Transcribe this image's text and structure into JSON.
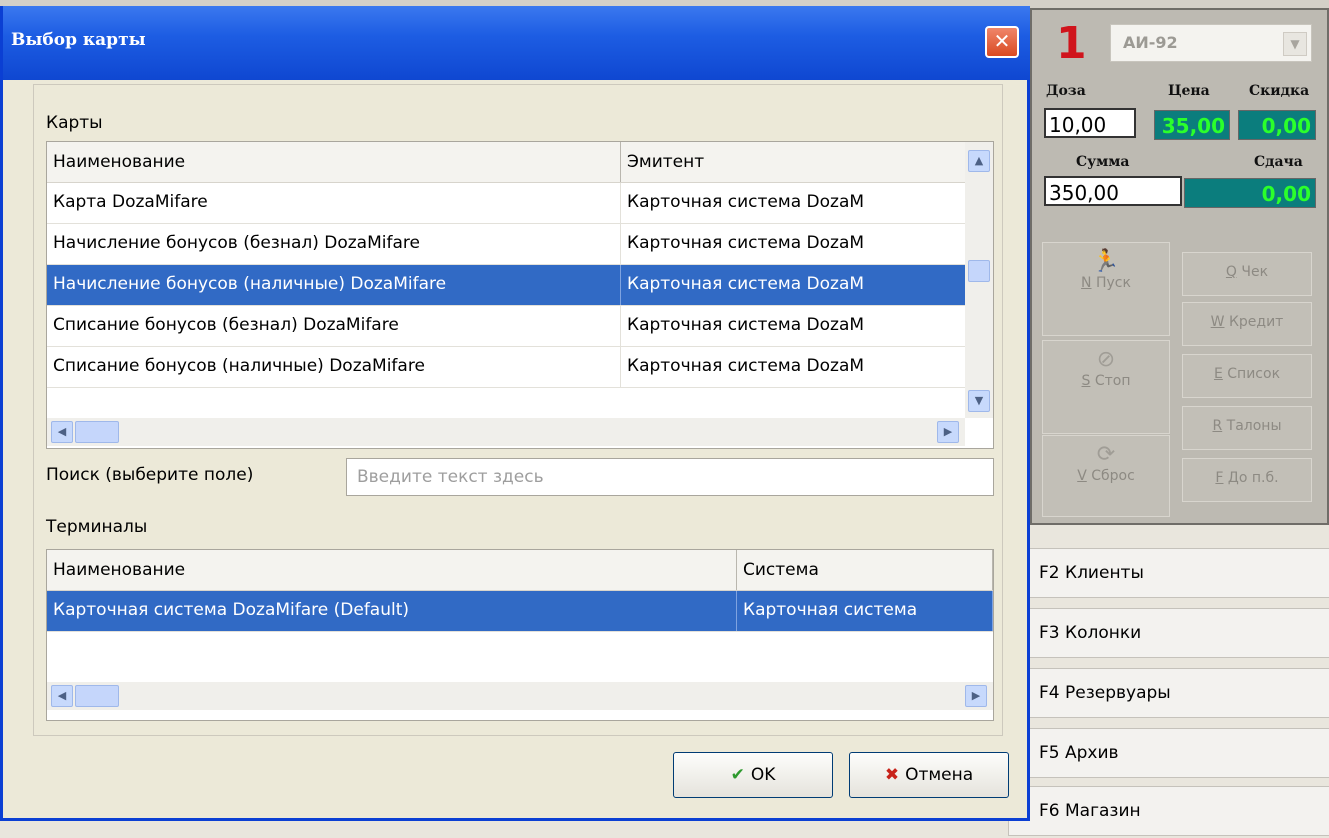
{
  "dialog": {
    "title": "Выбор карты",
    "cards_label": "Карты",
    "cards_grid": {
      "columns": [
        "Наименование",
        "Эмитент"
      ],
      "rows": [
        [
          "Карта DozaMifare",
          "Карточная система DozaM"
        ],
        [
          "Начисление бонусов (безнал) DozaMifare",
          "Карточная система DozaM"
        ],
        [
          "Начисление бонусов (наличные) DozaMifare",
          "Карточная система DozaM"
        ],
        [
          "Списание бонусов (безнал) DozaMifare",
          "Карточная система DozaM"
        ],
        [
          "Списание бонусов (наличные) DozaMifare",
          "Карточная система DozaM"
        ]
      ],
      "selected_row": 2
    },
    "search": {
      "label": "Поиск (выберите поле)",
      "placeholder": "Введите текст здесь"
    },
    "terminals_label": "Терминалы",
    "terminals_grid": {
      "columns": [
        "Наименование",
        "Система"
      ],
      "rows": [
        [
          "Карточная система DozaMifare (Default)",
          "Карточная система"
        ]
      ],
      "selected_row": 0
    },
    "ok_label": "OK",
    "cancel_label": "Отмена"
  },
  "pump": {
    "number": "1",
    "fuel": "АИ-92",
    "dose_label": "Доза",
    "price_label": "Цена",
    "discount_label": "Скидка",
    "dose_value": "10,00",
    "price_value": "35,00",
    "discount_value": "0,00",
    "sum_label": "Сумма",
    "change_label": "Сдача",
    "sum_value": "350,00",
    "change_value": "0,00",
    "buttons": {
      "start": {
        "key": "N",
        "text": " Пуск"
      },
      "stop": {
        "key": "S",
        "text": " Стоп"
      },
      "reset": {
        "key": "V",
        "text": " Сброс"
      },
      "check": {
        "key": "Q",
        "text": " Чек"
      },
      "credit": {
        "key": "W",
        "text": " Кредит"
      },
      "list": {
        "key": "E",
        "text": " Список"
      },
      "coupons": {
        "key": "R",
        "text": " Талоны"
      },
      "to_full": {
        "key": "F",
        "text": " До п.б."
      }
    }
  },
  "side_tabs": [
    "F2 Клиенты",
    "F3 Колонки",
    "F4 Резервуары",
    "F5 Архив",
    "F6 Магазин"
  ],
  "colors": {
    "title_bar": "#1d5de3",
    "selection": "#316ac5",
    "display_bg": "#0b7d7d",
    "display_text": "#2bff2b",
    "pump_number": "#d0141c"
  }
}
